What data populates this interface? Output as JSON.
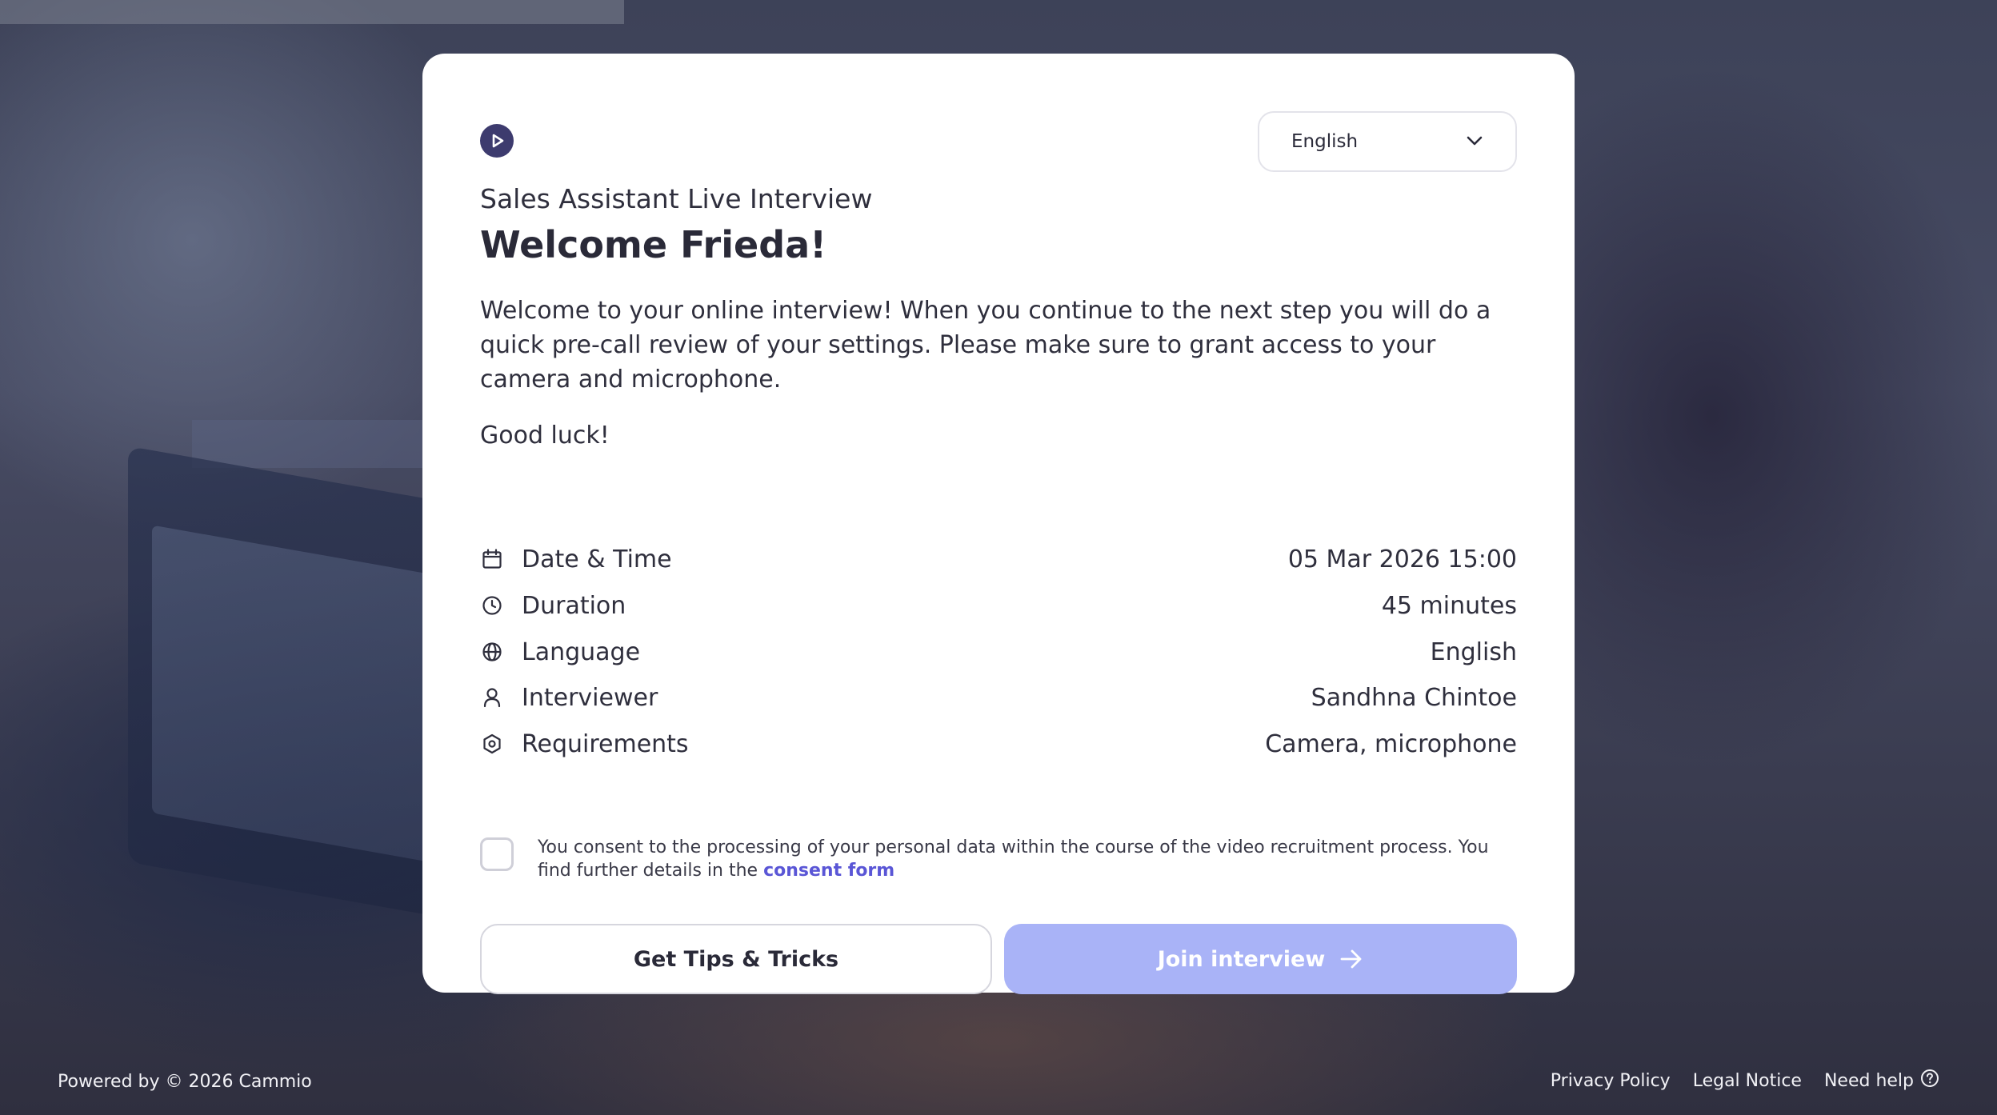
{
  "language_select": {
    "selected": "English",
    "icon": "chevron-down-icon"
  },
  "header": {
    "subtitle": "Sales Assistant Live Interview",
    "title": "Welcome Frieda!"
  },
  "intro": "Welcome to your online interview! When you continue to the next step you will do a quick pre-call review of your settings. Please make sure to grant access to your camera and microphone.",
  "good_luck": "Good luck!",
  "details": [
    {
      "icon": "calendar-icon",
      "label": "Date & Time",
      "value": "05 Mar 2026 15:00"
    },
    {
      "icon": "clock-icon",
      "label": "Duration",
      "value": "45 minutes"
    },
    {
      "icon": "globe-icon",
      "label": "Language",
      "value": "English"
    },
    {
      "icon": "user-icon",
      "label": "Interviewer",
      "value": "Sandhna Chintoe"
    },
    {
      "icon": "hexagon-settings-icon",
      "label": "Requirements",
      "value": "Camera, microphone"
    }
  ],
  "consent": {
    "text": "You consent to the processing of your personal data within the course of the video recruitment process. You find further details in the",
    "link": "consent form",
    "checked": false
  },
  "buttons": {
    "tips": "Get Tips & Tricks",
    "join": "Join interview"
  },
  "colors": {
    "brand": "#3d3b6e",
    "join_button_disabled": "#a9b3f7",
    "link": "#5a56d6"
  },
  "footer": {
    "powered": "Powered by © 2026 Cammio",
    "privacy": "Privacy Policy",
    "legal": "Legal Notice",
    "help": "Need help"
  }
}
